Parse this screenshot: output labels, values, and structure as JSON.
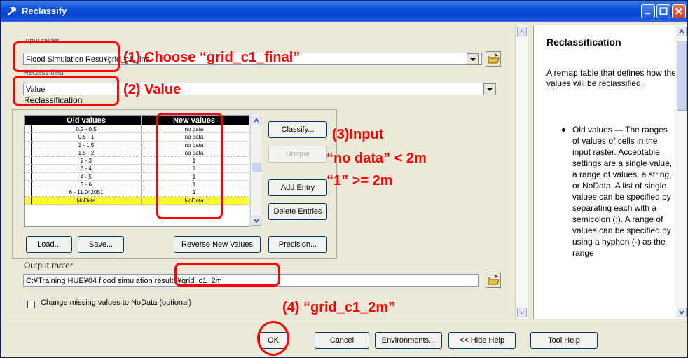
{
  "window": {
    "title": "Reclassify",
    "controls": [
      "minimize-icon",
      "maximize-icon",
      "close-icon"
    ]
  },
  "form": {
    "input_raster_label": "Input raster",
    "input_raster_value": "Flood Simulation Resu¥grid_c1_fina",
    "reclass_field_label": "Reclass field",
    "reclass_field_value": "Value",
    "reclassification_label": "Reclassification",
    "table": {
      "headers": [
        "Old values",
        "New values"
      ],
      "rows": [
        {
          "old": "0.2 - 0.5",
          "new": "no data"
        },
        {
          "old": "0.5 - 1",
          "new": "no data"
        },
        {
          "old": "1 - 1.5",
          "new": "no data"
        },
        {
          "old": "1.5 - 2",
          "new": "no data"
        },
        {
          "old": "2 - 3",
          "new": "1"
        },
        {
          "old": "3 - 4",
          "new": "1"
        },
        {
          "old": "4 - 5",
          "new": "1"
        },
        {
          "old": "5 - 6",
          "new": "1"
        },
        {
          "old": "6 - 11.042051",
          "new": "1"
        },
        {
          "old": "NoData",
          "new": "NoData"
        }
      ]
    },
    "buttons": {
      "classify": "Classify...",
      "unique": "Unique",
      "add_entry": "Add Entry",
      "delete_entries": "Delete Entries",
      "load": "Load...",
      "save": "Save...",
      "reverse": "Reverse New Values",
      "precision": "Precision..."
    },
    "output_raster_label": "Output raster",
    "output_raster_value": "C:¥Training HUE¥04 flood simulation results¥grid_c1_2m",
    "checkbox_label": "Change missing values to NoData (optional)"
  },
  "footer": {
    "ok": "OK",
    "cancel": "Cancel",
    "environments": "Environments...",
    "hide_help": "<< Hide Help",
    "tool_help": "Tool Help"
  },
  "help": {
    "title": "Reclassification",
    "intro": "A remap table that defines how the values will be reclassified.",
    "bullet": "Old values — The ranges of values of cells in the input raster. Acceptable settings are a single value, a range of values, a string, or NoData. A list of single values can be specified by separating each with a semicolon (;). A range of values can be specified by using a hyphen (-) as the range"
  },
  "annotations": {
    "step1": "(1) Choose “grid_c1_final”",
    "step2": "(2)  Value",
    "step3_line1": "(3)Input",
    "step3_line2": "“no data” < 2m",
    "step3_line3": "“1” >= 2m",
    "step4": "(4)  “grid_c1_2m”",
    "color": "#ff0000"
  },
  "colors": {
    "titlebar": "#0a4ed8",
    "dialog_bg": "#ece9d8",
    "highlight_row": "#fffd32"
  }
}
